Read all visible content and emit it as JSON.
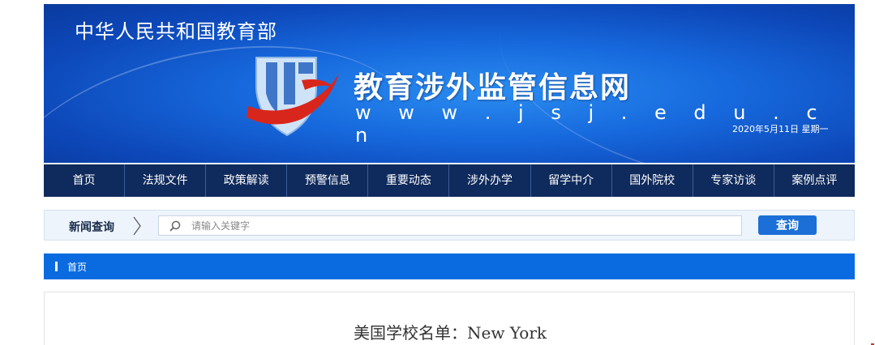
{
  "banner": {
    "ministry": "中华人民共和国教育部",
    "site_name": "教育涉外监管信息网",
    "site_url": "w w w . j s j . e d u . c n",
    "date": "2020年5月11日  星期一",
    "emblem_icon": "jsj-shield-logo",
    "colors": {
      "background": "#1668dc",
      "emblem_red": "#d9261c",
      "emblem_blue": "#9cc3ee"
    }
  },
  "nav": {
    "items": [
      {
        "label": "首页"
      },
      {
        "label": "法规文件"
      },
      {
        "label": "政策解读"
      },
      {
        "label": "预警信息"
      },
      {
        "label": "重要动态"
      },
      {
        "label": "涉外办学"
      },
      {
        "label": "留学中介"
      },
      {
        "label": "国外院校"
      },
      {
        "label": "专家访谈"
      },
      {
        "label": "案例点评"
      }
    ],
    "colors": {
      "background": "#0f2a5c"
    }
  },
  "search": {
    "label": "新闻查询",
    "placeholder": "请输入关键字",
    "value": "",
    "button_label": "查询",
    "icon": "search-icon"
  },
  "breadcrumb": {
    "home_label": "首页",
    "colors": {
      "background": "#0a6be0"
    }
  },
  "article": {
    "title": "美国学校名单：New York"
  }
}
